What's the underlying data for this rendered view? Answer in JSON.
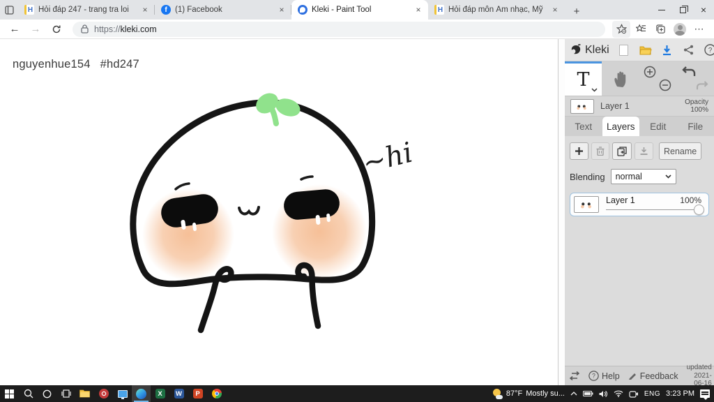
{
  "browser": {
    "tabs": [
      {
        "title": "Hỏi đáp 247 - trang tra loi"
      },
      {
        "title": "(1) Facebook"
      },
      {
        "title": "Kleki - Paint Tool"
      },
      {
        "title": "Hỏi đáp môn Âm nhạc, Mỹ thuật"
      }
    ],
    "glyphs": {
      "close": "×",
      "new_tab": "+",
      "back": "←",
      "forward": "→",
      "more": "⋯",
      "fav_h": "H",
      "fav_fb": "f"
    },
    "address": {
      "scheme": "https://",
      "host": "kleki.com"
    }
  },
  "canvas": {
    "artist_name": "nguyenhue154",
    "artist_tag": "#hd247",
    "hi_text": "~hi"
  },
  "kleki": {
    "app_name": "Kleki",
    "tools": {
      "text_label": "T"
    },
    "layer_info": {
      "name": "Layer 1",
      "opacity_label": "Opacity",
      "opacity_value": "100%"
    },
    "tabs": [
      {
        "label": "Text"
      },
      {
        "label": "Layers"
      },
      {
        "label": "Edit"
      },
      {
        "label": "File"
      }
    ],
    "layers_panel": {
      "rename_label": "Rename",
      "blending_label": "Blending",
      "blending_value": "normal",
      "layer_name": "Layer 1",
      "layer_opacity": "100%"
    },
    "footer": {
      "help_label": "Help",
      "feedback_label": "Feedback",
      "updated_label": "updated",
      "updated_date": "2021-06-16"
    }
  },
  "taskbar": {
    "tray": {
      "temperature": "87°F",
      "weather": "Mostly su...",
      "language": "ENG",
      "time": "3:23 PM"
    }
  },
  "colors": {
    "accent_blue": "#4a94e0",
    "sprout_green": "#90e28c",
    "blush": "#f5bc92",
    "taskbar": "#1d1d1d"
  }
}
